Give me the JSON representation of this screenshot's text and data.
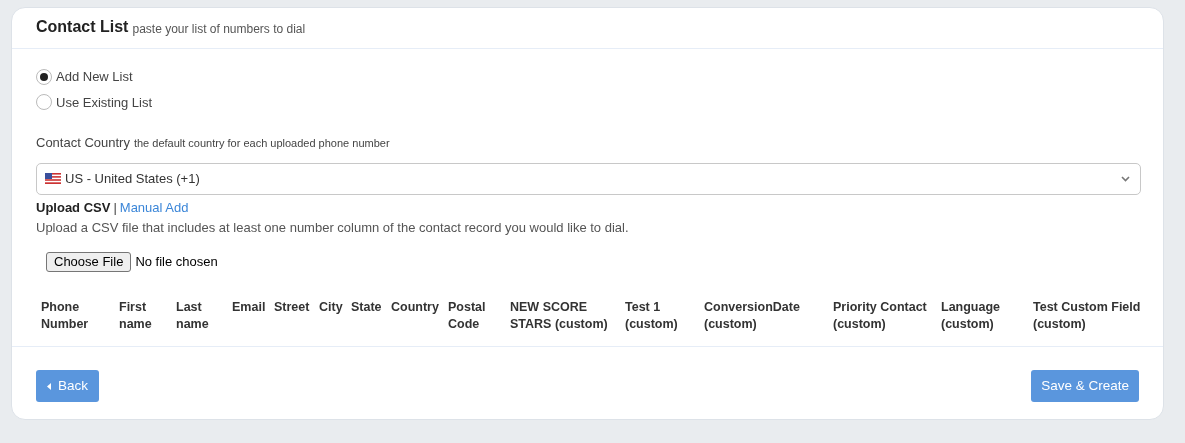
{
  "header": {
    "title": "Contact List",
    "subtitle": "paste your list of numbers to dial"
  },
  "list_mode": [
    {
      "label": "Add New List",
      "selected": true
    },
    {
      "label": "Use Existing List",
      "selected": false
    }
  ],
  "contact_country": {
    "label": "Contact Country",
    "hint": "the default country for each uploaded phone number",
    "value": "US - United States (+1)"
  },
  "upload_tabs": [
    {
      "label": "Upload CSV",
      "selected": true
    },
    {
      "label": "Manual Add",
      "selected": false
    }
  ],
  "tab_separator": "|",
  "upload_description": "Upload a CSV file that includes at least one number column of the contact record you would like to dial.",
  "file_input": {
    "button": "Choose File",
    "status": "No file chosen"
  },
  "table": {
    "columns": [
      [
        "Phone",
        "Number"
      ],
      [
        "First",
        "name"
      ],
      [
        "Last",
        "name"
      ],
      [
        "Email"
      ],
      [
        "Street"
      ],
      [
        "City"
      ],
      [
        "State"
      ],
      [
        "Country"
      ],
      [
        "Postal",
        "Code"
      ],
      [
        "NEW SCORE",
        "STARS (custom)"
      ],
      [
        "Test 1",
        "(custom)"
      ],
      [
        "ConversionDate",
        "(custom)"
      ],
      [
        "Priority Contact",
        "(custom)"
      ],
      [
        "Language",
        "(custom)"
      ],
      [
        "Test Custom Field",
        "(custom)"
      ]
    ]
  },
  "buttons": {
    "back": "Back",
    "save": "Save & Create"
  }
}
